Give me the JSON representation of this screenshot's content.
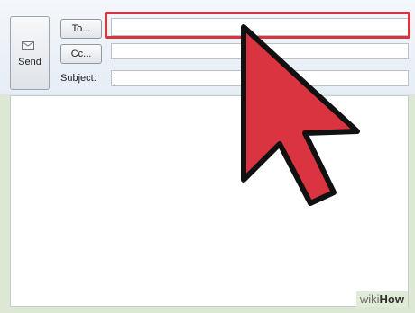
{
  "compose": {
    "send_label": "Send",
    "to_label": "To...",
    "cc_label": "Cc...",
    "subject_label": "Subject:",
    "to_value": "",
    "cc_value": "",
    "subject_value": "",
    "body_text": ""
  },
  "overlay": {
    "highlight_color": "#d9343f",
    "pointer_icon": "arrow-cursor-icon"
  },
  "watermark": {
    "wiki": "wiki",
    "how": "How"
  }
}
